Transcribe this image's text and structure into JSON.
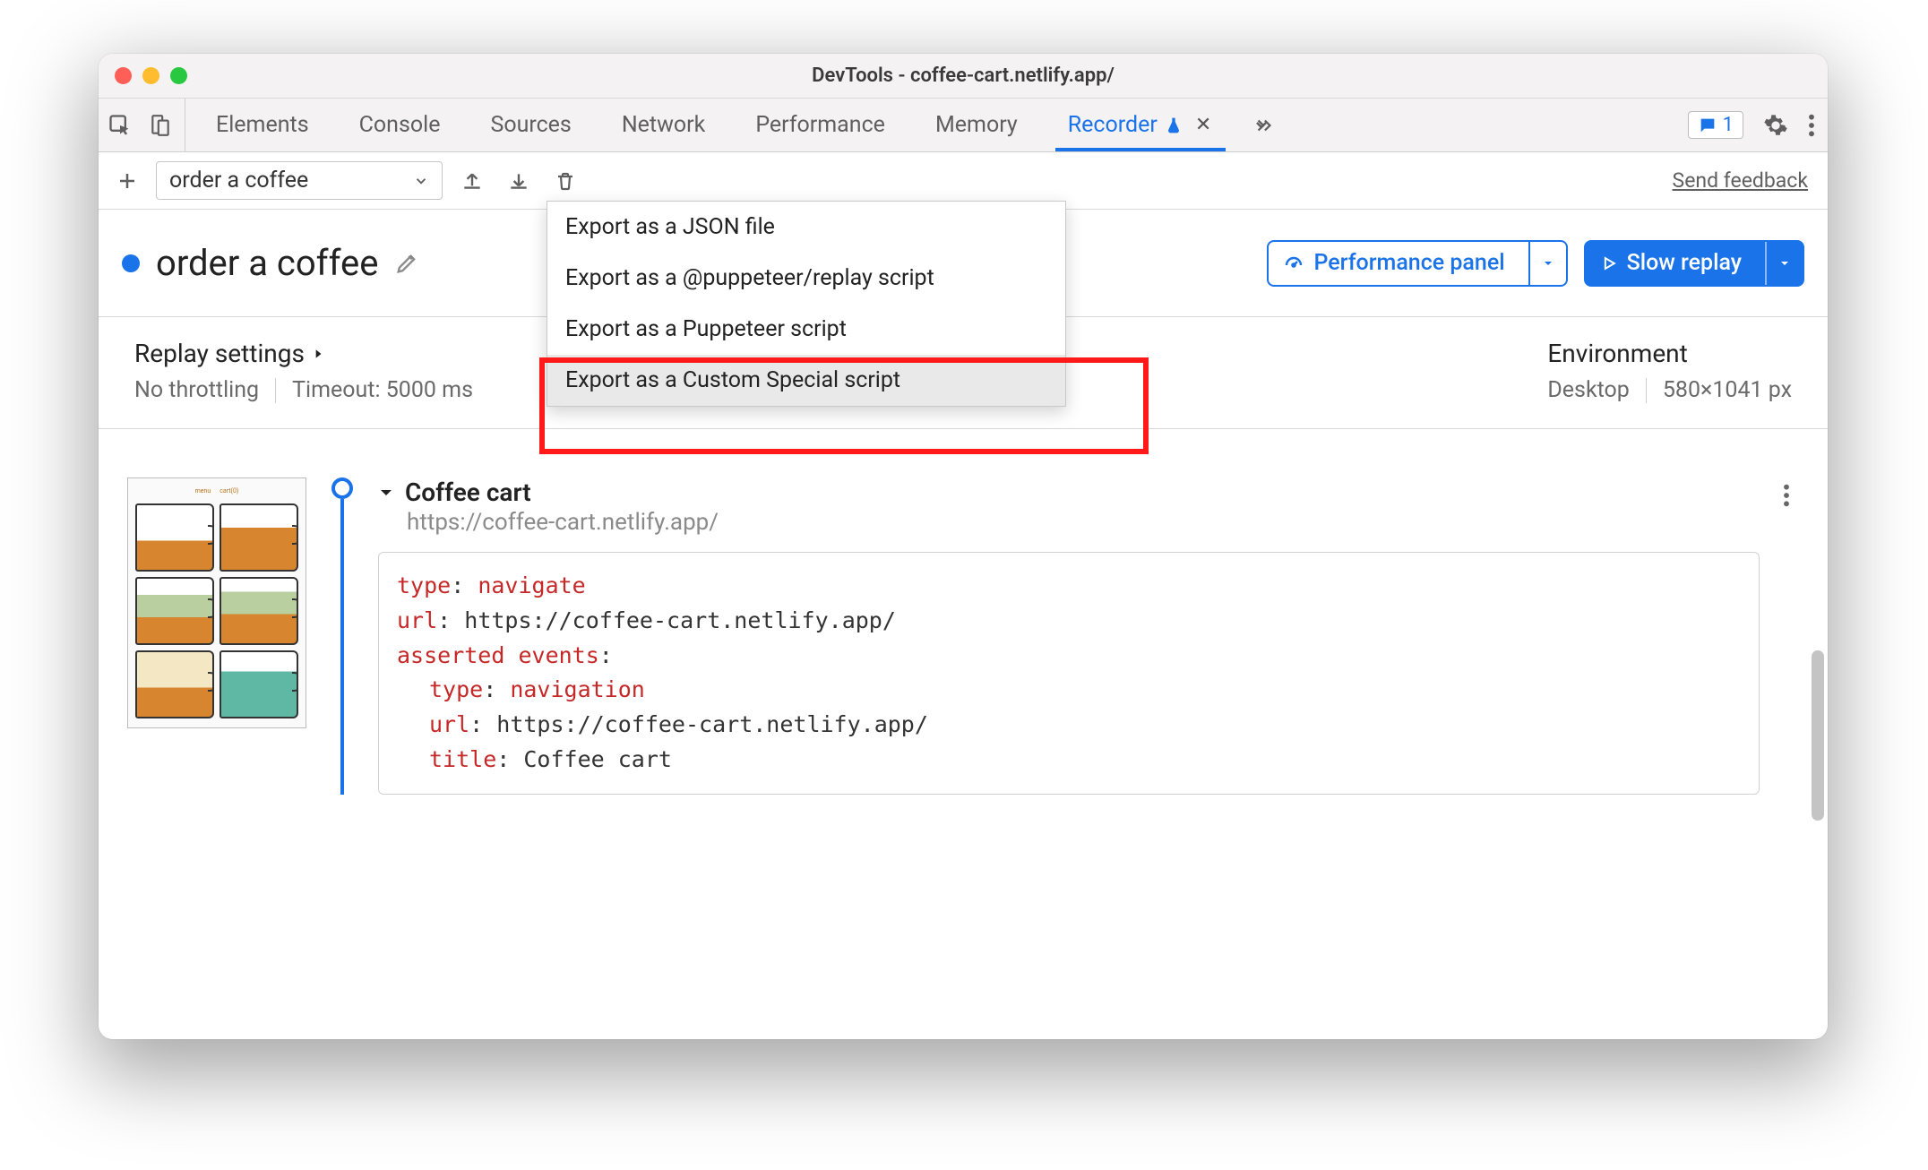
{
  "window": {
    "title": "DevTools - coffee-cart.netlify.app/"
  },
  "tabs": {
    "items": [
      "Elements",
      "Console",
      "Sources",
      "Network",
      "Performance",
      "Memory",
      "Recorder"
    ],
    "active": "Recorder",
    "issues_count": "1"
  },
  "toolbar": {
    "selected_recording": "order a coffee",
    "feedback": "Send feedback"
  },
  "heading": {
    "title": "order a coffee",
    "perf_label": "Performance panel",
    "replay_label": "Slow replay"
  },
  "export_menu": {
    "items": [
      "Export as a JSON file",
      "Export as a @puppeteer/replay script",
      "Export as a Puppeteer script",
      "Export as a Custom Special script"
    ],
    "hover_index": 3
  },
  "settings": {
    "title": "Replay settings",
    "throttle": "No throttling",
    "timeout": "Timeout: 5000 ms",
    "env_title": "Environment",
    "device": "Desktop",
    "viewport": "580×1041 px"
  },
  "step": {
    "title": "Coffee cart",
    "url": "https://coffee-cart.netlify.app/",
    "code": {
      "l1_k": "type",
      "l1_v": "navigate",
      "l2_k": "url",
      "l2_v": "https://coffee-cart.netlify.app/",
      "l3_k": "asserted events",
      "l4_k": "type",
      "l4_v": "navigation",
      "l5_k": "url",
      "l5_v": "https://coffee-cart.netlify.app/",
      "l6_k": "title",
      "l6_v": "Coffee cart"
    }
  }
}
